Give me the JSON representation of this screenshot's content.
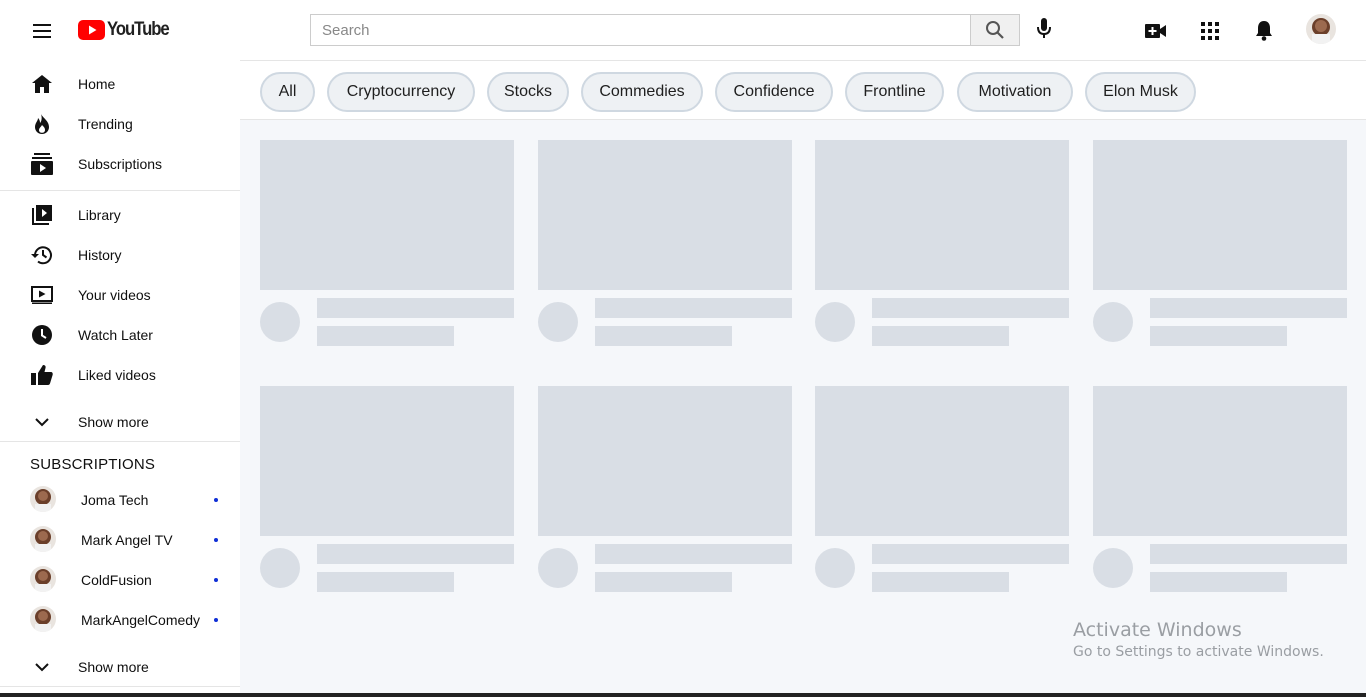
{
  "header": {
    "logo_text": "YouTube",
    "search_placeholder": "Search",
    "icons": [
      "menu-icon",
      "search-icon",
      "mic-icon",
      "create-video-icon",
      "apps-icon",
      "notifications-icon"
    ],
    "brand_color": "#ff0000"
  },
  "sidebar": {
    "primary": [
      {
        "label": "Home",
        "icon": "home-icon"
      },
      {
        "label": "Trending",
        "icon": "trending-icon"
      },
      {
        "label": "Subscriptions",
        "icon": "subscriptions-icon"
      }
    ],
    "secondary": [
      {
        "label": "Library",
        "icon": "library-icon"
      },
      {
        "label": "History",
        "icon": "history-icon"
      },
      {
        "label": "Your videos",
        "icon": "your-videos-icon"
      },
      {
        "label": "Watch Later",
        "icon": "watch-later-icon"
      },
      {
        "label": "Liked videos",
        "icon": "liked-videos-icon"
      }
    ],
    "show_more_1": "Show more",
    "subscriptions_heading": "SUBSCRIPTIONS",
    "subscriptions": [
      {
        "label": "Joma Tech"
      },
      {
        "label": "Mark Angel TV"
      },
      {
        "label": "ColdFusion"
      },
      {
        "label": "MarkAngelComedy"
      }
    ],
    "show_more_2": "Show more",
    "new_dot_color": "#0f2fd6"
  },
  "chips": [
    "All",
    "Cryptocurrency",
    "Stocks",
    "Commedies",
    "Confidence",
    "Frontline",
    "Motivation",
    "Elon Musk"
  ],
  "watermark": {
    "line1": "Activate Windows",
    "line2": "Go to Settings to activate Windows."
  }
}
